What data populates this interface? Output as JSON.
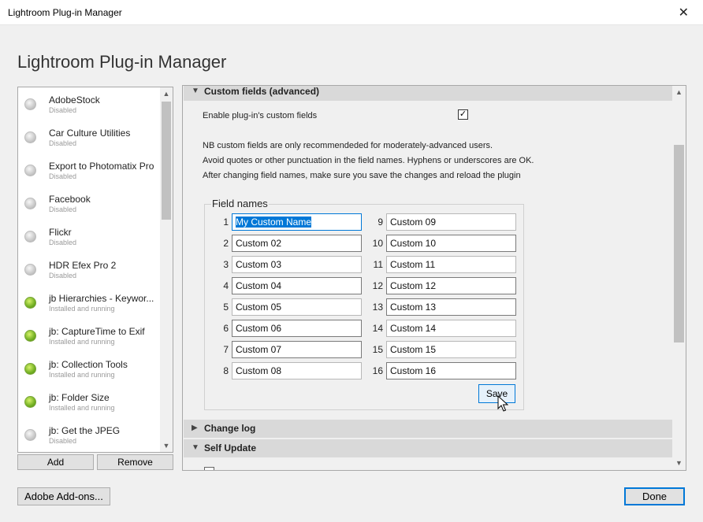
{
  "window": {
    "title": "Lightroom Plug-in Manager",
    "close_glyph": "✕"
  },
  "heading": "Lightroom Plug-in Manager",
  "plugins": [
    {
      "name": "AdobeStock",
      "status": "Disabled",
      "enabled": false
    },
    {
      "name": "Car Culture Utilities",
      "status": "Disabled",
      "enabled": false
    },
    {
      "name": "Export to Photomatix Pro",
      "status": "Disabled",
      "enabled": false
    },
    {
      "name": "Facebook",
      "status": "Disabled",
      "enabled": false
    },
    {
      "name": "Flickr",
      "status": "Disabled",
      "enabled": false
    },
    {
      "name": "HDR Efex Pro 2",
      "status": "Disabled",
      "enabled": false
    },
    {
      "name": "jb Hierarchies - Keywor...",
      "status": "Installed and running",
      "enabled": true
    },
    {
      "name": "jb: CaptureTime to Exif",
      "status": "Installed and running",
      "enabled": true
    },
    {
      "name": "jb: Collection Tools",
      "status": "Installed and running",
      "enabled": true
    },
    {
      "name": "jb: Folder Size",
      "status": "Installed and running",
      "enabled": true
    },
    {
      "name": "jb: Get the JPEG",
      "status": "Disabled",
      "enabled": false
    }
  ],
  "list_buttons": {
    "add": "Add",
    "remove": "Remove"
  },
  "sections": {
    "custom_fields": {
      "label": "Custom fields (advanced)",
      "expanded_glyph": "▼"
    },
    "change_log": {
      "label": "Change log",
      "collapsed_glyph": "▶"
    },
    "self_update": {
      "label": "Self Update",
      "expanded_glyph": "▼"
    }
  },
  "enable_custom_fields": {
    "label": "Enable plug-in's custom fields",
    "checked": true,
    "check_glyph": "✓"
  },
  "notes": [
    "NB custom fields are only recommendeded for moderately-advanced users.",
    "Avoid quotes or other punctuation in the field names. Hyphens or underscores are OK.",
    "After changing field names, make sure you save the changes and reload the plugin"
  ],
  "field_names": {
    "legend": "Field names",
    "fields": [
      {
        "num": "1",
        "value": "My Custom Name"
      },
      {
        "num": "2",
        "value": "Custom 02"
      },
      {
        "num": "3",
        "value": "Custom 03"
      },
      {
        "num": "4",
        "value": "Custom 04"
      },
      {
        "num": "5",
        "value": "Custom 05"
      },
      {
        "num": "6",
        "value": "Custom 06"
      },
      {
        "num": "7",
        "value": "Custom 07"
      },
      {
        "num": "8",
        "value": "Custom 08"
      },
      {
        "num": "9",
        "value": "Custom 09"
      },
      {
        "num": "10",
        "value": "Custom 10"
      },
      {
        "num": "11",
        "value": "Custom 11"
      },
      {
        "num": "12",
        "value": "Custom 12"
      },
      {
        "num": "13",
        "value": "Custom 13"
      },
      {
        "num": "14",
        "value": "Custom 14"
      },
      {
        "num": "15",
        "value": "Custom 15"
      },
      {
        "num": "16",
        "value": "Custom 16"
      }
    ],
    "save_label": "Save"
  },
  "footer": {
    "addons_label": "Adobe Add-ons...",
    "done_label": "Done"
  },
  "colors": {
    "accent": "#0078d7",
    "running": "#74b024",
    "disabled": "#c9c9c9"
  }
}
